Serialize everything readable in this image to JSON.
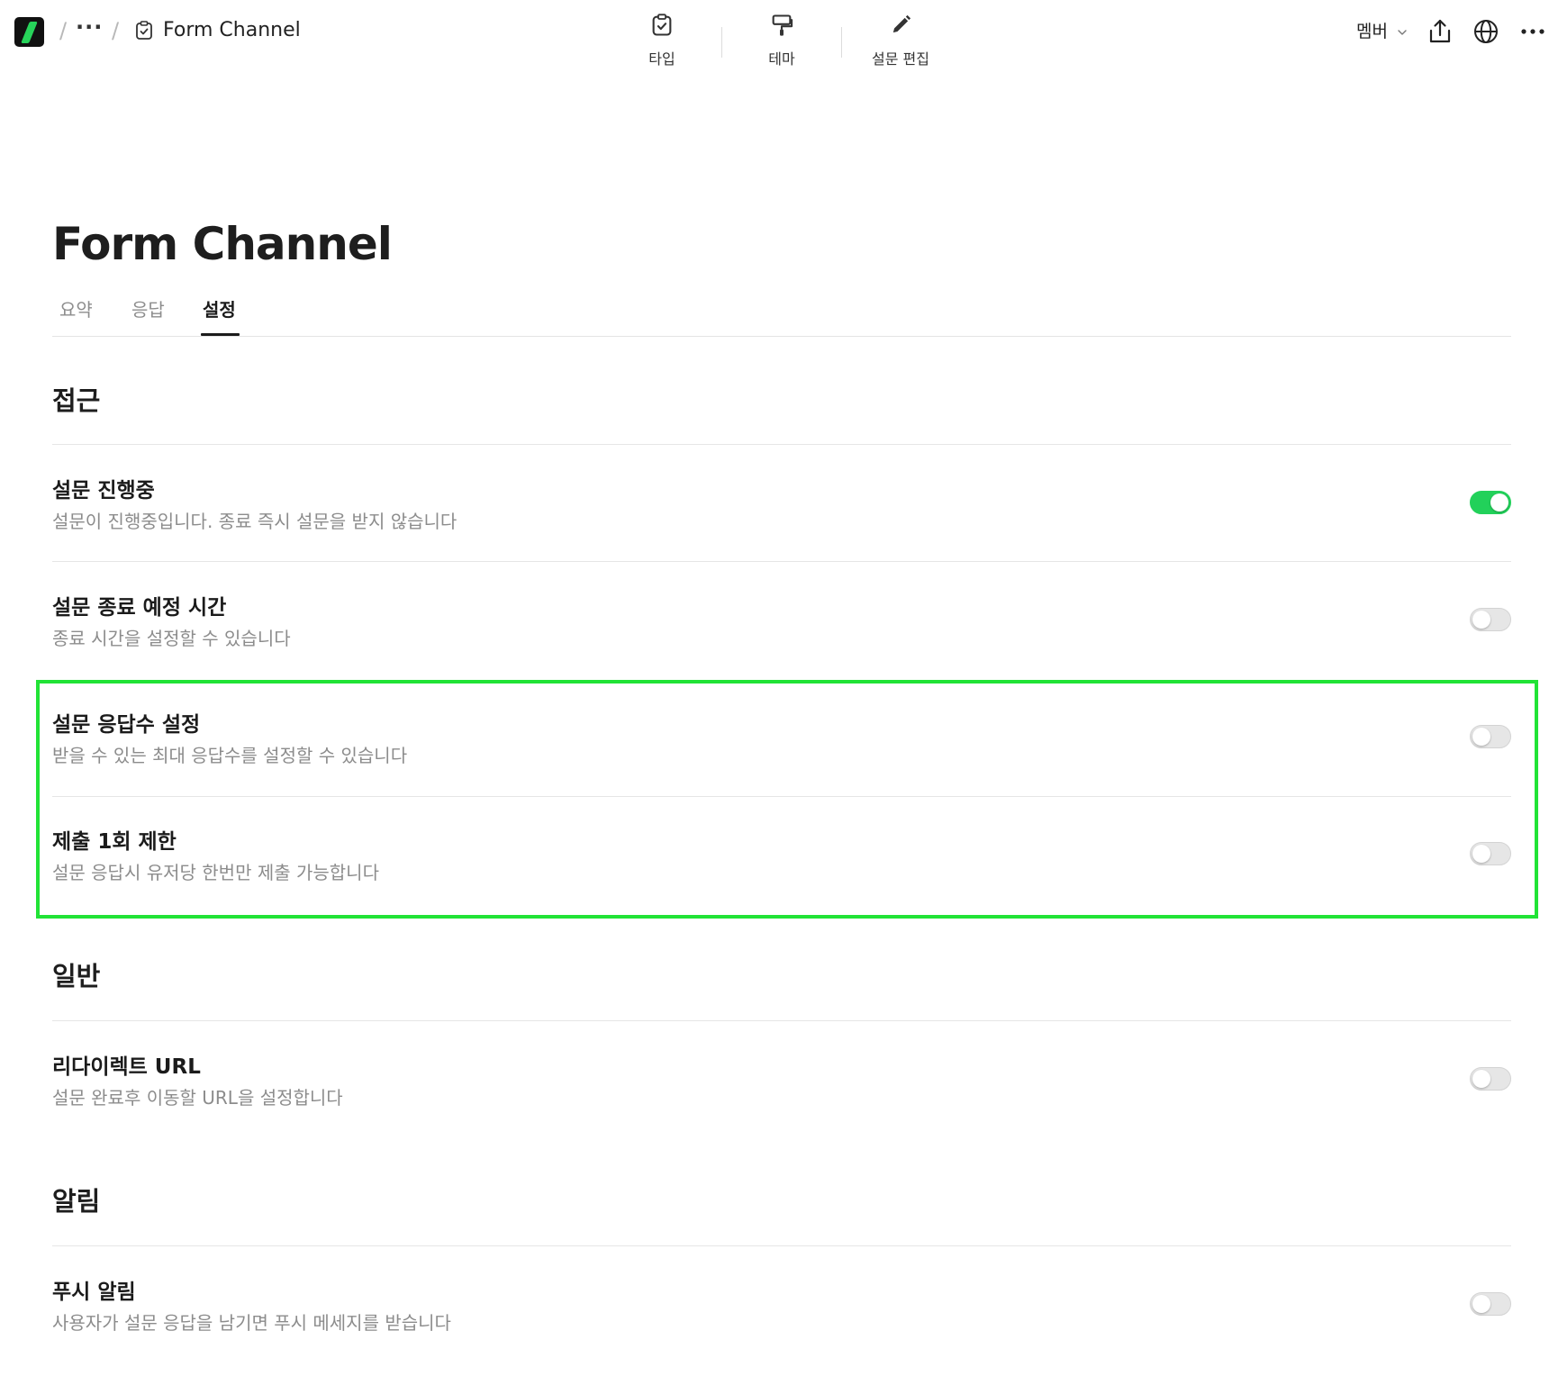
{
  "topbar": {
    "breadcrumb_more": "···",
    "breadcrumb_sep": "/",
    "doc_title": "Form Channel",
    "modes": [
      {
        "label": "타입",
        "icon": "clipboard-check-icon"
      },
      {
        "label": "테마",
        "icon": "paint-roller-icon"
      },
      {
        "label": "설문 편집",
        "icon": "pencil-icon"
      }
    ],
    "member_label": "멤버",
    "more_label": "···"
  },
  "page": {
    "title": "Form Channel",
    "tabs": [
      {
        "label": "요약",
        "active": false
      },
      {
        "label": "응답",
        "active": false
      },
      {
        "label": "설정",
        "active": true
      }
    ]
  },
  "sections": {
    "access": {
      "title": "접근",
      "rows": [
        {
          "title": "설문 진행중",
          "desc": "설문이 진행중입니다. 종료 즉시 설문을 받지 않습니다",
          "enabled": true
        },
        {
          "title": "설문 종료 예정 시간",
          "desc": "종료 시간을 설정할 수 있습니다",
          "enabled": false
        },
        {
          "title": "설문 응답수 설정",
          "desc": "받을 수 있는 최대 응답수를 설정할 수 있습니다",
          "enabled": false
        },
        {
          "title": "제출 1회 제한",
          "desc": "설문 응답시 유저당 한번만 제출 가능합니다",
          "enabled": false
        }
      ]
    },
    "general": {
      "title": "일반",
      "rows": [
        {
          "title": "리다이렉트 URL",
          "desc": "설문 완료후 이동할 URL을 설정합니다",
          "enabled": false
        }
      ]
    },
    "notify": {
      "title": "알림",
      "rows": [
        {
          "title": "푸시 알림",
          "desc": "사용자가 설문 응답을 남기면 푸시 메세지를 받습니다",
          "enabled": false
        }
      ]
    }
  },
  "colors": {
    "toggle_on": "#22d15a",
    "highlight": "#21e336",
    "brand_logo": "#27d35a"
  }
}
